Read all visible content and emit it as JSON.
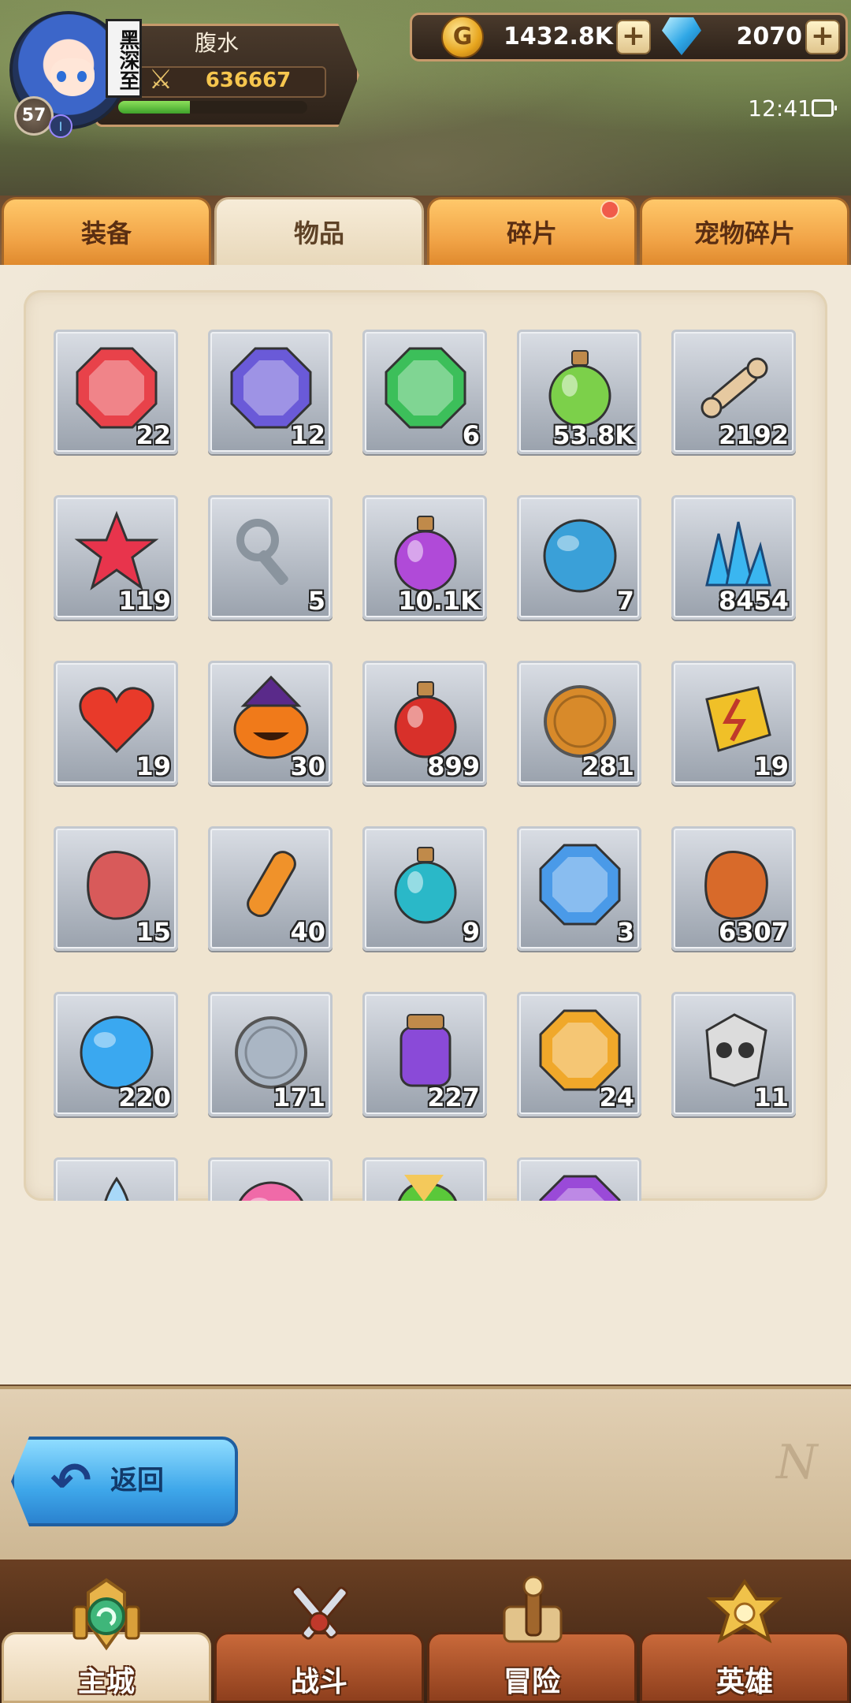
{
  "player": {
    "name": "腹水",
    "title_badge": "黑深至",
    "power": "636667",
    "level": "57",
    "vip": "I",
    "xp_fraction": 0.38
  },
  "currency": {
    "gold": "1432.8K",
    "gems": "2070",
    "plus": "+"
  },
  "status": {
    "time": "12:41"
  },
  "tabs": [
    {
      "label": "装备",
      "active": false
    },
    {
      "label": "物品",
      "active": true
    },
    {
      "label": "碎片",
      "active": false,
      "has_notification": true
    },
    {
      "label": "宠物碎片",
      "active": false
    }
  ],
  "items": [
    {
      "icon": "red-sword-gem-icon",
      "qty": "22",
      "color": "#e8424a"
    },
    {
      "icon": "purple-boot-gem-icon",
      "qty": "12",
      "color": "#6a5ad8"
    },
    {
      "icon": "green-glove-gem-icon",
      "qty": "6",
      "color": "#3cbf5a"
    },
    {
      "icon": "green-potion-icon",
      "qty": "53.8K",
      "color": "#7cd04a"
    },
    {
      "icon": "bone-icon",
      "qty": "2192",
      "color": "#e6c9a0"
    },
    {
      "icon": "red-star-crystal-icon",
      "qty": "119",
      "color": "#e8344c"
    },
    {
      "icon": "key-icon",
      "qty": "5",
      "color": "#8a949e"
    },
    {
      "icon": "purple-potion-icon",
      "qty": "10.1K",
      "color": "#b04ad8"
    },
    {
      "icon": "blue-egg-icon",
      "qty": "7",
      "color": "#3aa0d8"
    },
    {
      "icon": "blue-crystals-icon",
      "qty": "8454",
      "color": "#3ab6f0"
    },
    {
      "icon": "heart-icon",
      "qty": "19",
      "color": "#e83a2a"
    },
    {
      "icon": "pumpkin-icon",
      "qty": "30",
      "color": "#f07a1a"
    },
    {
      "icon": "red-potion-icon",
      "qty": "899",
      "color": "#d8302a"
    },
    {
      "icon": "bronze-sword-coin-icon",
      "qty": "281",
      "color": "#d88a2a"
    },
    {
      "icon": "lightning-rune-icon",
      "qty": "19",
      "color": "#f0c028"
    },
    {
      "icon": "meat-icon",
      "qty": "15",
      "color": "#d85a5a"
    },
    {
      "icon": "orange-vial-icon",
      "qty": "40",
      "color": "#f0922a"
    },
    {
      "icon": "teal-flask-icon",
      "qty": "9",
      "color": "#2ab8c8"
    },
    {
      "icon": "blue-shield-gem-icon",
      "qty": "3",
      "color": "#4a9ae8"
    },
    {
      "icon": "copper-ore-icon",
      "qty": "6307",
      "color": "#d86a2a"
    },
    {
      "icon": "blue-orb-icon",
      "qty": "220",
      "color": "#3aa8f0"
    },
    {
      "icon": "silver-coin-icon",
      "qty": "171",
      "color": "#aab6c4"
    },
    {
      "icon": "purple-jar-icon",
      "qty": "227",
      "color": "#8a4ad8"
    },
    {
      "icon": "gold-armor-gem-icon",
      "qty": "24",
      "color": "#f0a82a"
    },
    {
      "icon": "skull-shard-icon",
      "qty": "11",
      "color": "#dcdcdc"
    },
    {
      "icon": "water-drop-icon",
      "qty": "",
      "color": "#a8d8f8"
    },
    {
      "icon": "pink-candy-icon",
      "qty": "",
      "color": "#f06aa8"
    },
    {
      "icon": "green-leaf-icon",
      "qty": "",
      "color": "#5ac83a"
    },
    {
      "icon": "purple-gem-icon",
      "qty": "",
      "color": "#9a4ad8"
    }
  ],
  "back_button": {
    "label": "返回"
  },
  "bottom_nav": [
    {
      "label": "主城",
      "active": true,
      "icon": "castle-emblem-icon"
    },
    {
      "label": "战斗",
      "active": false,
      "icon": "crossed-swords-icon"
    },
    {
      "label": "冒险",
      "active": false,
      "icon": "map-scroll-icon"
    },
    {
      "label": "英雄",
      "active": false,
      "icon": "hero-crest-icon"
    }
  ]
}
